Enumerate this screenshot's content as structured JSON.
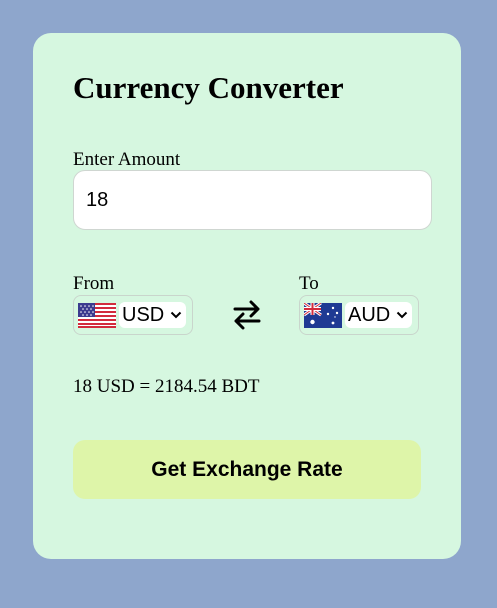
{
  "title": "Currency Converter",
  "amount": {
    "label": "Enter Amount",
    "value": "18"
  },
  "from": {
    "label": "From",
    "currency": "USD",
    "flag_icon": "us-flag-icon"
  },
  "to": {
    "label": "To",
    "currency": "AUD",
    "flag_icon": "au-flag-icon"
  },
  "swap_icon": "swap-arrows-icon",
  "result": "18 USD = 2184.54 BDT",
  "button_label": "Get Exchange Rate",
  "colors": {
    "page_background": "#8ea6cc",
    "card_background": "#d6f7e0",
    "button_background": "#def5a9"
  }
}
